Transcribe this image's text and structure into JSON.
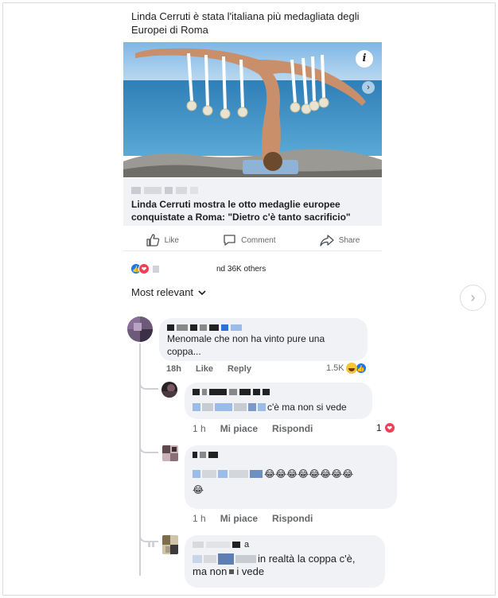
{
  "post": {
    "title": "Linda Cerruti è stata l'italiana più medagliata degli Europei di Roma",
    "link_headline": "Linda Cerruti mostra le otto medaglie europee conquistate a Roma: \"Dietro c'è tanto sacrificio\"",
    "info_glyph": "i",
    "next_glyph": "›"
  },
  "actions": {
    "like": "Like",
    "comment": "Comment",
    "share": "Share"
  },
  "reactions": {
    "summary_text": "nd 36K others",
    "like_glyph": "👍",
    "love_glyph": "❤"
  },
  "sort": {
    "label": "Most relevant",
    "chevron": "⌄"
  },
  "outer_nav": {
    "next_glyph": "›"
  },
  "comments": [
    {
      "text": "Menomale che non ha vinto pure una coppa...",
      "time": "18h",
      "like": "Like",
      "reply": "Reply",
      "reaction_count": "1.5K"
    }
  ],
  "replies": [
    {
      "text": "c'è ma non si vede",
      "time": "1 h",
      "like": "Mi piace",
      "reply": "Rispondi",
      "reaction_count": "1"
    },
    {
      "text": "😂😂😂😂😂😂😂😂",
      "text2": "😂",
      "time": "1 h",
      "like": "Mi piace",
      "reply": "Rispondi"
    },
    {
      "text": "in realtà la coppa c'è,",
      "text2": "ma non",
      "text3": "i vede",
      "prefix": "a"
    }
  ],
  "colors": {
    "accent_blue": "#1877f2",
    "love_red": "#f33e58",
    "bubble_bg": "#f0f2f5",
    "muted_text": "#65676b"
  }
}
